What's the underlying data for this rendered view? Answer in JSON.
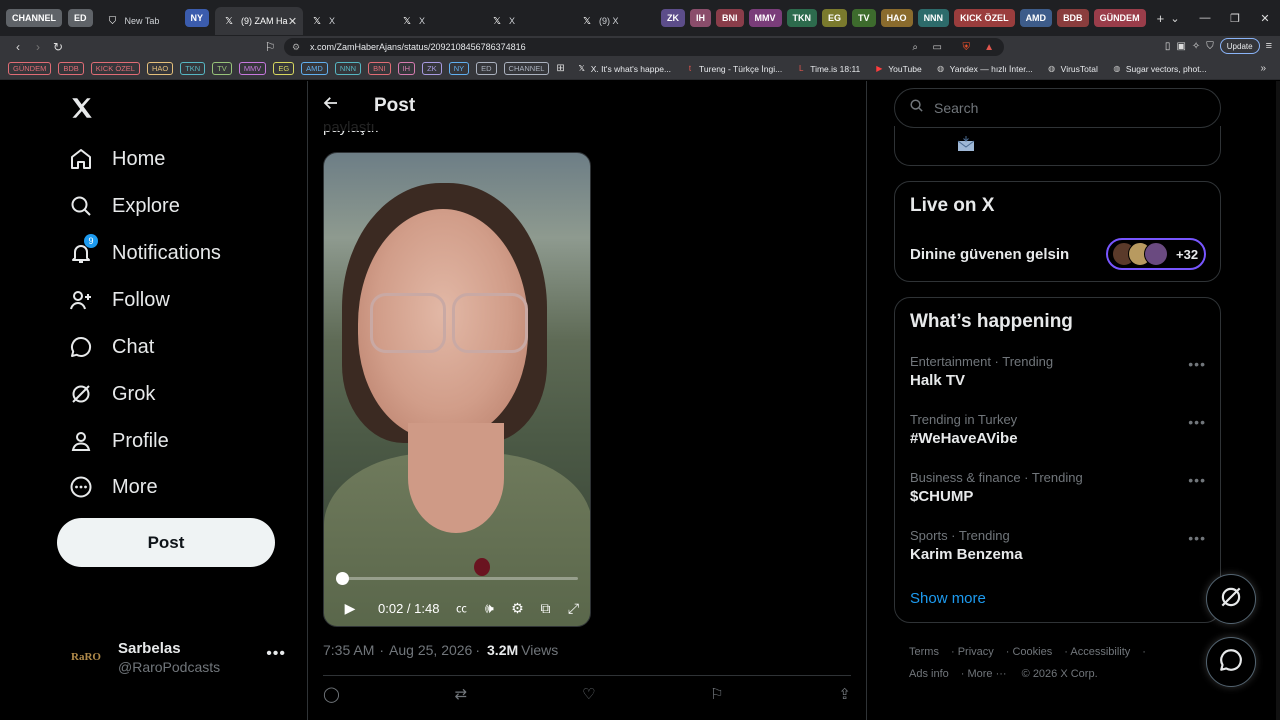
{
  "browser": {
    "tab_groups": [
      {
        "label": "CHANNEL",
        "color": "#5f6368"
      },
      {
        "label": "ED",
        "color": "#5f6368"
      }
    ],
    "tabs": [
      {
        "title": "New Tab",
        "icon": "shield-icon"
      },
      {
        "title": "NY",
        "chip": true,
        "color": "#3b5cad"
      },
      {
        "title": "(9) ZAM Ha",
        "icon": "x-logo-icon",
        "active": true
      },
      {
        "title": "X",
        "icon": "x-logo-icon"
      },
      {
        "title": "X",
        "icon": "x-logo-icon"
      },
      {
        "title": "X",
        "icon": "x-logo-icon"
      },
      {
        "title": "(9) X",
        "icon": "x-logo-icon"
      }
    ],
    "right_groups": [
      {
        "label": "ZK",
        "color": "#5c4d8a"
      },
      {
        "label": "IH",
        "color": "#8a4d6b"
      },
      {
        "label": "BNI",
        "color": "#8a3d4a"
      },
      {
        "label": "MMV",
        "color": "#7a3d7a"
      },
      {
        "label": "TKN",
        "color": "#2d6b4d"
      },
      {
        "label": "EG",
        "color": "#7a7a2d"
      },
      {
        "label": "TV",
        "color": "#3d6b2d"
      },
      {
        "label": "HAO",
        "color": "#8a6b2d"
      },
      {
        "label": "NNN",
        "color": "#2d6b6b"
      },
      {
        "label": "KICK ÖZEL",
        "color": "#9a3d3d"
      },
      {
        "label": "AMD",
        "color": "#3d5c8a"
      },
      {
        "label": "BDB",
        "color": "#8a3d3d"
      },
      {
        "label": "GÜNDEM",
        "color": "#9a3d4a"
      }
    ],
    "url": "x.com/ZamHaberAjans/status/2092108456786374816",
    "update_label": "Update",
    "bookmark_chips": [
      {
        "label": "GÜNDEM",
        "color": "#e06c75"
      },
      {
        "label": "BDB",
        "color": "#e06c75"
      },
      {
        "label": "KICK ÖZEL",
        "color": "#e06c75"
      },
      {
        "label": "HAO",
        "color": "#e5c07b"
      },
      {
        "label": "TKN",
        "color": "#56b6c2"
      },
      {
        "label": "TV",
        "color": "#98c379"
      },
      {
        "label": "MMV",
        "color": "#c678dd"
      },
      {
        "label": "EG",
        "color": "#d7d75f"
      },
      {
        "label": "AMD",
        "color": "#61afef"
      },
      {
        "label": "NNN",
        "color": "#56b6c2"
      },
      {
        "label": "BNI",
        "color": "#e06c75"
      },
      {
        "label": "IH",
        "color": "#d67bb0"
      },
      {
        "label": "ZK",
        "color": "#a89be0"
      },
      {
        "label": "NY",
        "color": "#61afef"
      },
      {
        "label": "ED",
        "color": "#abb2bf"
      },
      {
        "label": "CHANNEL",
        "color": "#abb2bf"
      }
    ],
    "bookmark_links": [
      {
        "label": "X. It's what's happe...",
        "icon": "x-logo-icon"
      },
      {
        "label": "Tureng - Türkçe İngi...",
        "icon": "tureng-icon"
      },
      {
        "label": "Time.is 18:11",
        "icon": "time-icon"
      },
      {
        "label": "YouTube",
        "icon": "youtube-icon"
      },
      {
        "label": "Yandex — hızlı İnter...",
        "icon": "globe-icon"
      },
      {
        "label": "VirusTotal",
        "icon": "globe-icon"
      },
      {
        "label": "Sugar vectors, phot...",
        "icon": "globe-icon"
      }
    ]
  },
  "nav": {
    "items": [
      {
        "label": "Home",
        "icon": "home-icon"
      },
      {
        "label": "Explore",
        "icon": "search-icon"
      },
      {
        "label": "Notifications",
        "icon": "bell-icon",
        "badge": "9"
      },
      {
        "label": "Follow",
        "icon": "follow-icon"
      },
      {
        "label": "Chat",
        "icon": "chat-icon"
      },
      {
        "label": "Grok",
        "icon": "grok-icon"
      },
      {
        "label": "Profile",
        "icon": "profile-icon"
      },
      {
        "label": "More",
        "icon": "more-circle-icon"
      }
    ],
    "post_button": "Post",
    "account": {
      "name": "Sarbelas",
      "handle": "@RaroPodcasts",
      "avatar_text": "RaRO"
    }
  },
  "main": {
    "header_title": "Post",
    "cut_text": "paylaştı.",
    "video": {
      "time": "0:02 / 1:48",
      "progress": 0.02
    },
    "meta": {
      "time": "7:35 AM",
      "date": "Aug 25, 2026",
      "views": "3.2M",
      "views_label": "Views"
    }
  },
  "right": {
    "search_placeholder": "Search",
    "live": {
      "title": "Live on X",
      "space_title": "Dinine güvenen gelsin",
      "count": "+32"
    },
    "happening": {
      "title": "What’s happening",
      "trends": [
        {
          "category": "Entertainment · Trending",
          "name": "Halk TV"
        },
        {
          "category": "Trending in Turkey",
          "name": "#WeHaveAVibe"
        },
        {
          "category": "Business & finance · Trending",
          "name": "$CHUMP"
        },
        {
          "category": "Sports · Trending",
          "name": "Karim Benzema"
        }
      ],
      "show_more": "Show more"
    },
    "footer": [
      "Terms",
      "Privacy",
      "Cookies",
      "Accessibility",
      "Ads info",
      "More ···",
      "© 2026 X Corp."
    ]
  }
}
